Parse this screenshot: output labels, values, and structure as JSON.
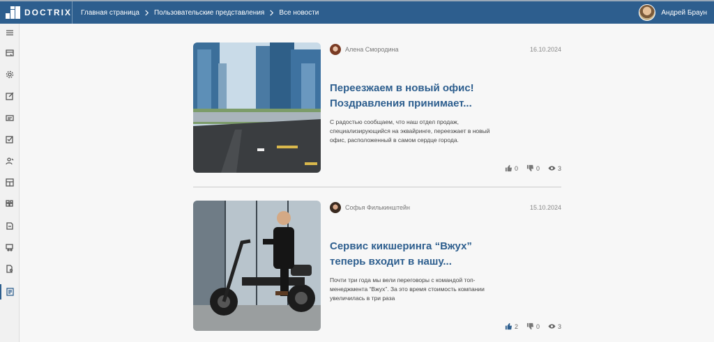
{
  "brand": {
    "name": "DOCTRIX"
  },
  "breadcrumbs": [
    "Главная страница",
    "Пользовательские представления",
    "Все новости"
  ],
  "user": {
    "name": "Андрей Браун"
  },
  "sidebar": {
    "items": [
      {
        "icon": "menu-icon"
      },
      {
        "icon": "inbox-icon"
      },
      {
        "icon": "gear-icon"
      },
      {
        "icon": "edit-icon"
      },
      {
        "icon": "card-icon"
      },
      {
        "icon": "checkbox-icon"
      },
      {
        "icon": "users-icon"
      },
      {
        "icon": "layout-icon"
      },
      {
        "icon": "grid-icon"
      },
      {
        "icon": "document-icon"
      },
      {
        "icon": "car-icon"
      },
      {
        "icon": "file-search-icon"
      },
      {
        "icon": "news-icon"
      }
    ]
  },
  "posts": [
    {
      "author": "Алена Смородина",
      "date": "16.10.2024",
      "title": "Переезжаем в новый офис! Поздравления принимает...",
      "excerpt": "С радостью сообщаем, что наш отдел продаж, специализирующийся на эквайринге, переезжает в новый офис, расположенный в самом сердце города.",
      "likes": "0",
      "dislikes": "0",
      "views": "3"
    },
    {
      "author": "Софья Филькинштейн",
      "date": "15.10.2024",
      "title": "Сервис кикшеринга “Вжух” теперь входит в нашу...",
      "excerpt": "Почти три года мы вели переговоры с командой топ-менеджмента “Вжух”. За это время стоимость компании увеличилась в три раза",
      "likes": "2",
      "dislikes": "0",
      "views": "3"
    }
  ],
  "colors": {
    "header": "#2d5e8e",
    "title": "#2d5e8e",
    "like_active": "#2d5e8e"
  }
}
